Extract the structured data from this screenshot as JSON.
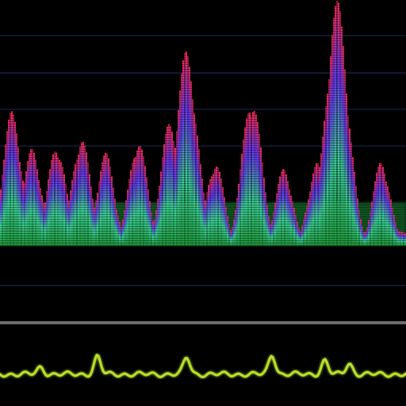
{
  "image": {
    "corner_text": "",
    "colors": {
      "background": "#000000",
      "grid_line": "#1c2a55",
      "separator": "#6a6a6a",
      "waveform": "#b8e02a",
      "spectrum_low": "#1f9a3a",
      "spectrum_mid": "#3fd6a0",
      "spectrum_high": "#6a3cff",
      "spectrum_peak": "#ff2a55"
    },
    "spectrum_peaks": [
      {
        "position": 0.03,
        "level": 0.55
      },
      {
        "position": 0.08,
        "level": 0.4
      },
      {
        "position": 0.14,
        "level": 0.42
      },
      {
        "position": 0.2,
        "level": 0.45
      },
      {
        "position": 0.26,
        "level": 0.38
      },
      {
        "position": 0.34,
        "level": 0.44
      },
      {
        "position": 0.42,
        "level": 0.52
      },
      {
        "position": 0.46,
        "level": 0.8
      },
      {
        "position": 0.53,
        "level": 0.35
      },
      {
        "position": 0.62,
        "level": 0.62
      },
      {
        "position": 0.7,
        "level": 0.32
      },
      {
        "position": 0.78,
        "level": 0.34
      },
      {
        "position": 0.83,
        "level": 1.0
      },
      {
        "position": 0.94,
        "level": 0.35
      }
    ],
    "waveform_peaks": [
      {
        "position": 0.1,
        "level": 0.35
      },
      {
        "position": 0.24,
        "level": 0.9
      },
      {
        "position": 0.46,
        "level": 0.85
      },
      {
        "position": 0.67,
        "level": 1.0
      },
      {
        "position": 0.8,
        "level": 0.7
      },
      {
        "position": 0.86,
        "level": 0.55
      }
    ]
  }
}
